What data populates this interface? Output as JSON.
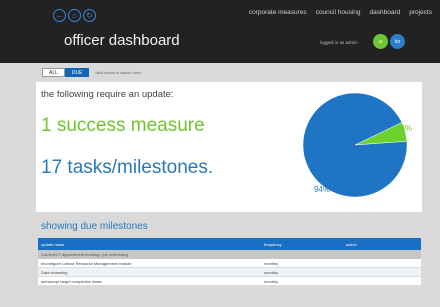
{
  "header": {
    "title": "officer dashboard",
    "nav_icons": [
      "back-icon",
      "home-icon",
      "refresh-icon"
    ],
    "menu": [
      "corporate measures",
      "council housing",
      "dashboard",
      "projects"
    ],
    "logout_text": "logged in as admin",
    "avatars": [
      "a",
      "bo"
    ],
    "colors": {
      "background": "#222222",
      "icon": "#3b86d6",
      "avatar_green": "#6fc634",
      "avatar_blue": "#2c7ec9"
    }
  },
  "filter": {
    "all_label": "ALL",
    "due_label": "DUE",
    "selected": "DUE",
    "note": "click below to switch view"
  },
  "summary": {
    "heading": "the following require an update:",
    "measures": "1 success measure",
    "tasks": "17 tasks/milestones.",
    "colors": {
      "measures": "#72c22e",
      "tasks": "#2a78b8"
    }
  },
  "chart_data": {
    "type": "pie",
    "slices": [
      {
        "label": "6%",
        "value": 6,
        "color": "#6fd12e"
      },
      {
        "label": "94%",
        "value": 94,
        "color": "#1f74c4"
      }
    ]
  },
  "milestones": {
    "title": "showing due milestones",
    "columns": [
      "update name",
      "frequency",
      "action"
    ],
    "group": "Carrier/ICT Appointment booking / job scheduling",
    "rows": [
      {
        "name": "reconfigure Labour Resource Management module",
        "frequency": "monthly",
        "action": ""
      },
      {
        "name": "Data cleansing",
        "frequency": "monthly",
        "action": ""
      },
      {
        "name": "set/accept target completion dates",
        "frequency": "monthly",
        "action": ""
      }
    ]
  }
}
